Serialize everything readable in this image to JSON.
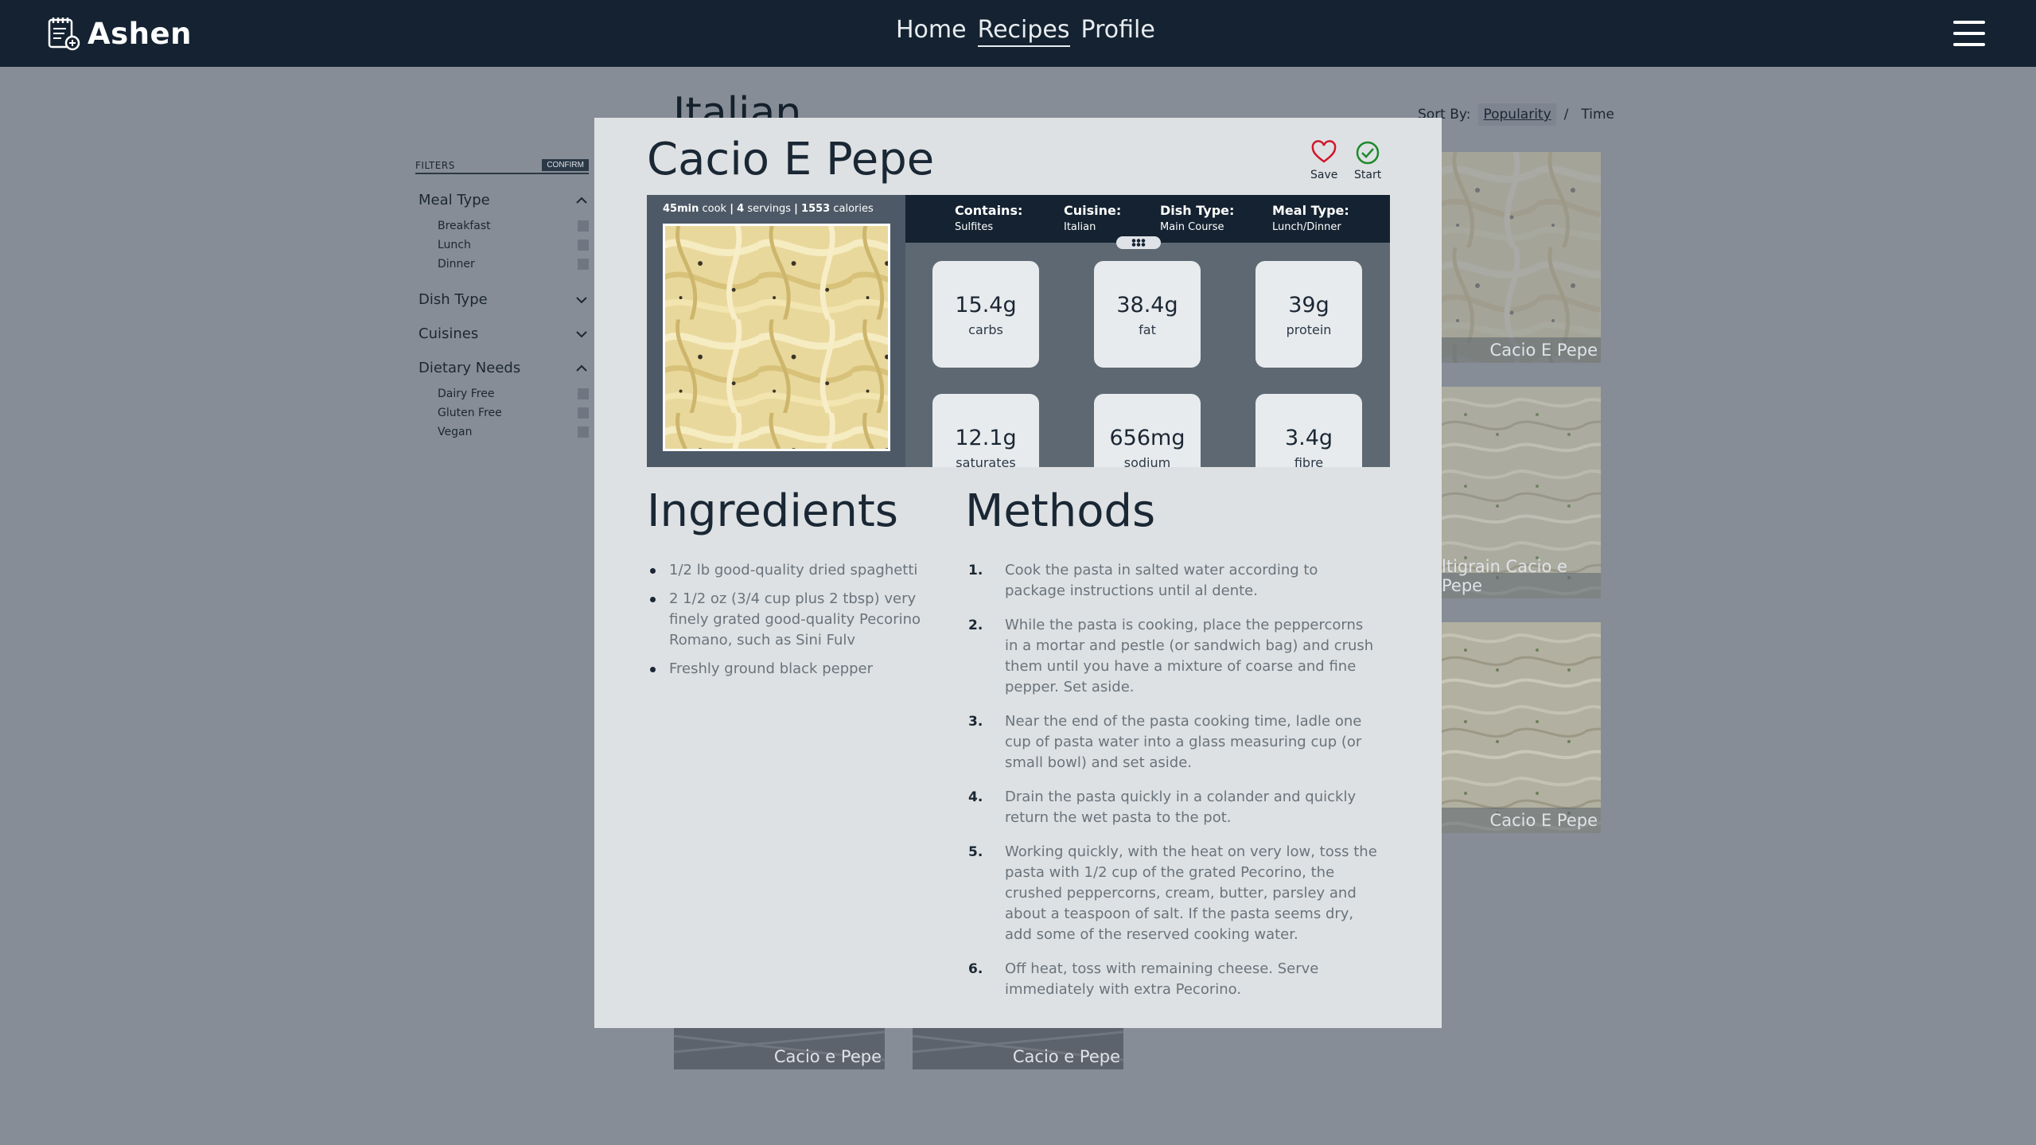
{
  "nav": {
    "brand": "Ashen",
    "links": [
      {
        "label": "Home",
        "active": false
      },
      {
        "label": "Recipes",
        "active": true
      },
      {
        "label": "Profile",
        "active": false
      }
    ],
    "menu_icon": "hamburger-menu-icon"
  },
  "page": {
    "heading": "Italian",
    "sort": {
      "label": "Sort By:",
      "options": [
        "Popularity",
        "Time"
      ],
      "separator": "/",
      "active": "Popularity"
    }
  },
  "filters": {
    "title": "FILTERS",
    "confirm": "CONFIRM",
    "groups": [
      {
        "title": "Meal Type",
        "expanded": true,
        "items": [
          "Breakfast",
          "Lunch",
          "Dinner"
        ]
      },
      {
        "title": "Dish Type",
        "expanded": false,
        "items": []
      },
      {
        "title": "Cuisines",
        "expanded": false,
        "items": []
      },
      {
        "title": "Dietary Needs",
        "expanded": true,
        "items": [
          "Dairy Free",
          "Gluten Free",
          "Vegan"
        ]
      }
    ]
  },
  "cards": [
    {
      "label": "Cacio E Pepe"
    },
    {
      "label": "ltigrain Cacio e Pepe"
    },
    {
      "label": "Cacio E Pepe"
    },
    {
      "label": "Cacio e Pepe"
    },
    {
      "label": "Cacio e Pepe"
    }
  ],
  "modal": {
    "title": "Cacio E Pepe",
    "save": "Save",
    "start": "Start",
    "meta": {
      "time": "45min",
      "time_unit": "cook",
      "servings": "4",
      "servings_unit": "servings",
      "calories": "1553",
      "calories_unit": "calories",
      "sep": "|"
    },
    "tags": [
      {
        "key": "Contains:",
        "value": "Sulfites"
      },
      {
        "key": "Cuisine:",
        "value": "Italian"
      },
      {
        "key": "Dish Type:",
        "value": "Main Course"
      },
      {
        "key": "Meal Type:",
        "value": "Lunch/Dinner"
      }
    ],
    "nutrition": [
      {
        "value": "15.4g",
        "label": "carbs"
      },
      {
        "value": "38.4g",
        "label": "fat"
      },
      {
        "value": "39g",
        "label": "protein"
      },
      {
        "value": "12.1g",
        "label": "saturates"
      },
      {
        "value": "656mg",
        "label": "sodium"
      },
      {
        "value": "3.4g",
        "label": "fibre"
      }
    ],
    "ingredients_title": "Ingredients",
    "ingredients": [
      "1/2 lb good-quality dried spaghetti",
      "2 1/2 oz (3/4 cup plus 2 tbsp) very finely grated good-quality Pecorino Romano, such as Sini Fulv",
      "Freshly ground black pepper"
    ],
    "methods_title": "Methods",
    "methods": [
      {
        "num": "1.",
        "text": "Cook the pasta in salted water according to package instructions until al dente."
      },
      {
        "num": "2.",
        "text": "While the pasta is cooking, place the peppercorns in a mortar and pestle (or sandwich bag) and crush them until you have a mixture of coarse and fine pepper. Set aside."
      },
      {
        "num": "3.",
        "text": "Near the end of the pasta cooking time, ladle one cup of pasta water into a glass measuring cup (or small bowl) and set aside."
      },
      {
        "num": "4.",
        "text": "Drain the pasta quickly in a colander and quickly return the wet pasta to the pot."
      },
      {
        "num": "5.",
        "text": "Working quickly, with the heat on very low, toss the pasta with 1/2 cup of the grated Pecorino, the crushed peppercorns, cream, butter, parsley and about a teaspoon of salt. If the pasta seems dry, add some of the reserved cooking water."
      },
      {
        "num": "6.",
        "text": "Off heat, toss with remaining cheese. Serve immediately with extra Pecorino."
      }
    ]
  },
  "colors": {
    "nav_bg": "#142231",
    "overlay_bg": "#878d96",
    "modal_bg": "#dee1e3",
    "save_heart": "#d0182a",
    "start_check": "#1e8a2e"
  }
}
